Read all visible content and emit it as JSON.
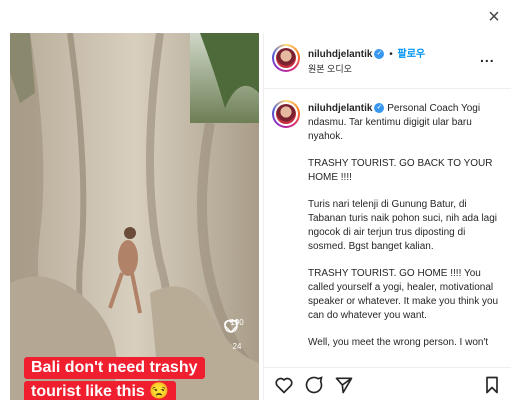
{
  "window": {
    "close_icon": "close-icon"
  },
  "media": {
    "caption_lines": [
      "Bali don't need trashy",
      "tourist like this 😒"
    ],
    "like_count": "190",
    "comment_count": "24"
  },
  "post": {
    "username": "niluhdjelantik",
    "follow_label": "팔로우",
    "separator": "•",
    "audio_label": "원본 오디오",
    "more_label": "..."
  },
  "caption": {
    "username": "niluhdjelantik",
    "paragraphs": [
      "Personal Coach Yogi ndasmu. Tar kentimu digigit ular baru nyahok.",
      "TRASHY TOURIST. GO BACK TO YOUR HOME !!!!",
      "Turis nari telenji di Gunung Batur, di Tabanan turis naik pohon suci, nih ada lagi ngocok di air terjun trus diposting di sosmed. Bgst banget kalian.",
      "TRASHY TOURIST. GO HOME !!!! You called yourself a yogi, healer, motivational speaker or whatever. It make you think you can do whatever you want.",
      "Well, you meet the wrong person. I won't"
    ]
  },
  "colors": {
    "verified": "#3897f0",
    "follow": "#0095f6",
    "caption_bg": "#ef1f2f",
    "text": "#262626"
  }
}
